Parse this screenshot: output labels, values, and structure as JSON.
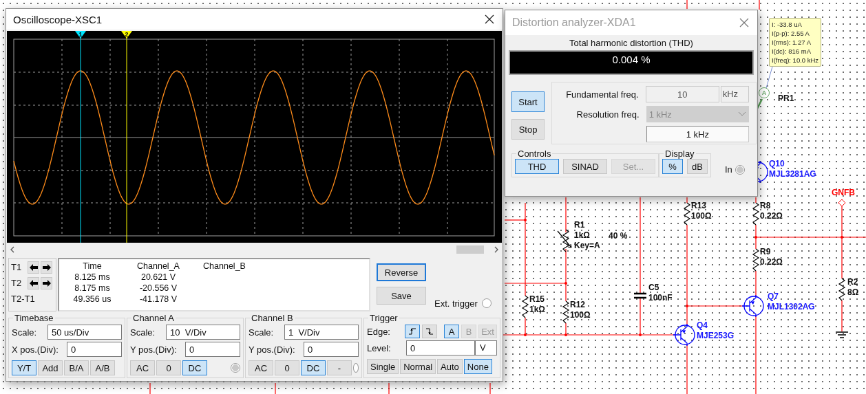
{
  "oscilloscope": {
    "title": "Oscilloscope-XSC1",
    "cursors": [
      {
        "label": "1",
        "color": "#00e5ff"
      },
      {
        "label": "2",
        "color": "#ffff00"
      }
    ],
    "readout": {
      "columns": [
        "Time",
        "Channel_A",
        "Channel_B"
      ],
      "rows": [
        {
          "label": "T1",
          "arrows": true,
          "values": [
            "8.125 ms",
            "20.621 V"
          ]
        },
        {
          "label": "T2",
          "arrows": true,
          "values": [
            "8.175 ms",
            "-20.556 V"
          ]
        },
        {
          "label": "T2-T1",
          "arrows": false,
          "values": [
            "49.356 us",
            "-41.178 V"
          ]
        }
      ]
    },
    "buttons": [
      {
        "label": "Reverse",
        "selected": true
      },
      {
        "label": "Save",
        "selected": false
      }
    ],
    "ext_trigger": {
      "label": "Ext. trigger"
    },
    "panels": [
      {
        "kind": "timebase",
        "title": "Timebase",
        "fields": [
          {
            "label": "Scale:",
            "value": "50 us/Div"
          },
          {
            "label": "X pos.(Div):",
            "value": "0"
          }
        ],
        "modes": [
          {
            "label": "Y/T",
            "selected": true
          },
          {
            "label": "Add",
            "selected": false
          },
          {
            "label": "B/A",
            "selected": false
          },
          {
            "label": "A/B",
            "selected": false
          }
        ]
      },
      {
        "kind": "channel",
        "title": "Channel A",
        "fields": [
          {
            "label": "Scale:",
            "value": "10  V/Div"
          },
          {
            "label": "Y pos.(Div):",
            "value": "0"
          }
        ],
        "modes": [
          {
            "label": "AC",
            "selected": false
          },
          {
            "label": "0",
            "selected": false
          },
          {
            "label": "DC",
            "selected": true
          }
        ],
        "indicator_on": true
      },
      {
        "kind": "channel",
        "title": "Channel B",
        "fields": [
          {
            "label": "Scale:",
            "value": "1  V/Div"
          },
          {
            "label": "Y pos.(Div):",
            "value": "0"
          }
        ],
        "modes": [
          {
            "label": "AC",
            "selected": false
          },
          {
            "label": "0",
            "selected": false
          },
          {
            "label": "DC",
            "selected": true
          },
          {
            "label": "-",
            "selected": false
          }
        ],
        "indicator_on": false
      },
      {
        "kind": "trigger",
        "title": "Trigger",
        "edge_label": "Edge:",
        "edges": [
          {
            "kind": "rising",
            "selected": true
          },
          {
            "kind": "falling",
            "selected": false
          }
        ],
        "sources": [
          {
            "label": "A",
            "selected": true,
            "disabled": false
          },
          {
            "label": "B",
            "selected": false,
            "disabled": true
          },
          {
            "label": "Ext",
            "selected": false,
            "disabled": true
          }
        ],
        "level": {
          "label": "Level:",
          "value": "0",
          "unit": "V"
        },
        "modes": [
          {
            "label": "Single",
            "selected": false
          },
          {
            "label": "Normal",
            "selected": false
          },
          {
            "label": "Auto",
            "selected": false
          },
          {
            "label": "None",
            "selected": true
          }
        ]
      }
    ]
  },
  "distortion": {
    "title": "Distortion analyzer-XDA1",
    "thd": {
      "label": "Total harmonic distortion (THD)",
      "reading": "0.004 %"
    },
    "actions": [
      {
        "label": "Start",
        "selected": true
      },
      {
        "label": "Stop",
        "selected": false
      }
    ],
    "fundamental": {
      "label": "Fundamental freq.",
      "value": "10",
      "unit": "kHz"
    },
    "resolution": {
      "label": "Resolution freq.",
      "value": "1 kHz",
      "output": "1 kHz"
    },
    "controls": {
      "title": "Controls",
      "buttons": [
        {
          "label": "THD",
          "selected": true,
          "disabled": false
        },
        {
          "label": "SINAD",
          "selected": false,
          "disabled": false
        },
        {
          "label": "Set...",
          "selected": false,
          "disabled": true
        }
      ]
    },
    "display": {
      "title": "Display",
      "buttons": [
        {
          "label": "%",
          "selected": true
        },
        {
          "label": "dB",
          "selected": false
        }
      ]
    },
    "input": {
      "label": "In"
    }
  },
  "probe": {
    "name": "PR1",
    "symbol": "A",
    "readings": [
      "I: -33.8 uA",
      "I(p-p): 2.55 A",
      "I(rms): 1.27 A",
      "I(dc): 816 mA",
      "I(freq): 10.0 kHz"
    ]
  },
  "circuit": {
    "parts": [
      {
        "kind": "transistor",
        "ref": "Q10",
        "value": "MJL3281AG"
      },
      {
        "kind": "resistor",
        "ref": "R13",
        "value": "100Ω"
      },
      {
        "kind": "resistor",
        "ref": "R8",
        "value": "0.22Ω"
      },
      {
        "kind": "potentiometer",
        "ref": "R1",
        "value": "1kΩ",
        "key": "Key=A",
        "setting": "40 %"
      },
      {
        "kind": "resistor",
        "ref": "R9",
        "value": "0.22Ω"
      },
      {
        "kind": "resistor",
        "ref": "R2",
        "value": "8Ω"
      },
      {
        "kind": "capacitor",
        "ref": "C5",
        "value": "100nF"
      },
      {
        "kind": "resistor",
        "ref": "R15",
        "value": "1kΩ"
      },
      {
        "kind": "resistor",
        "ref": "R12",
        "value": "100Ω"
      },
      {
        "kind": "transistor",
        "ref": "Q7",
        "value": "MJL1302AG"
      },
      {
        "kind": "transistor",
        "ref": "Q4",
        "value": "MJE253G"
      }
    ],
    "nets": [
      {
        "label": "GNFB"
      }
    ]
  }
}
